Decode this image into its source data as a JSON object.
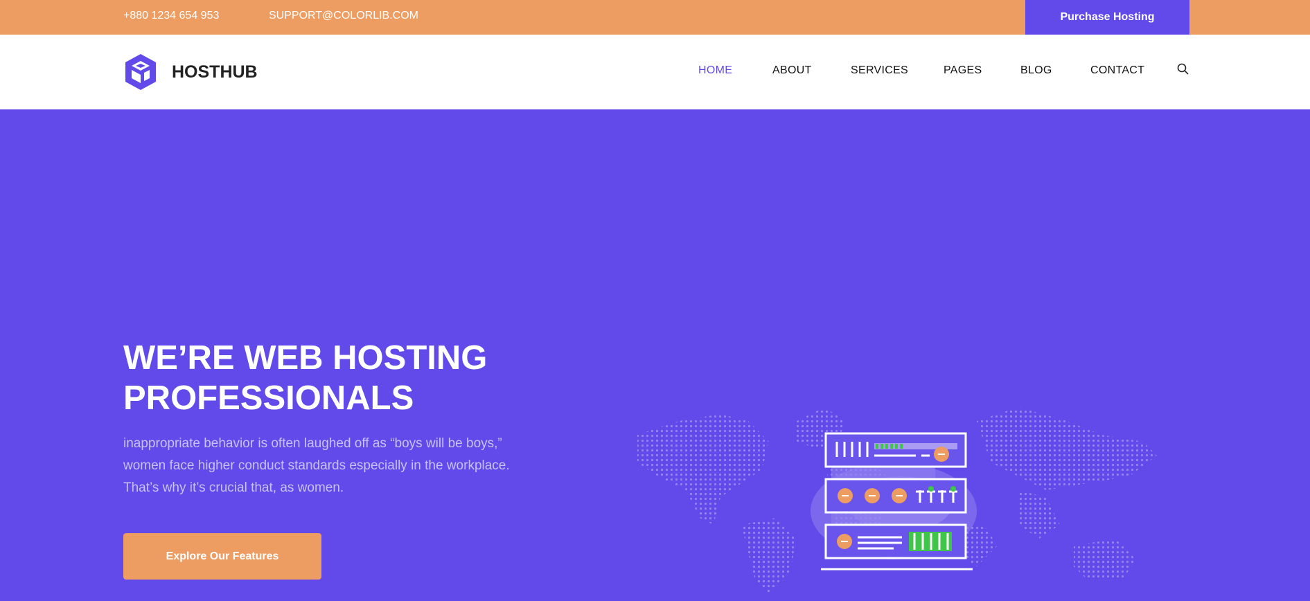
{
  "topbar": {
    "phone": "+880 1234 654 953",
    "email": "SUPPORT@COLORLIB.COM",
    "purchase_label": "Purchase Hosting"
  },
  "brand": {
    "name": "HOSTHUB",
    "accent": "#614ae9",
    "orange": "#ed9d61"
  },
  "nav": {
    "items": [
      {
        "label": "HOME",
        "active": true
      },
      {
        "label": "ABOUT"
      },
      {
        "label": "SERVICES"
      },
      {
        "label": "PAGES"
      },
      {
        "label": "BLOG"
      },
      {
        "label": "CONTACT"
      }
    ],
    "search_icon": "search-icon"
  },
  "hero": {
    "title_line1": "WE’RE WEB HOSTING",
    "title_line2": "PROFESSIONALS",
    "text": "inappropriate behavior is often laughed off as “boys will be boys,” women face higher conduct standards especially in the workplace. That’s why it’s crucial that, as women.",
    "cta_label": "Explore Our Features"
  }
}
